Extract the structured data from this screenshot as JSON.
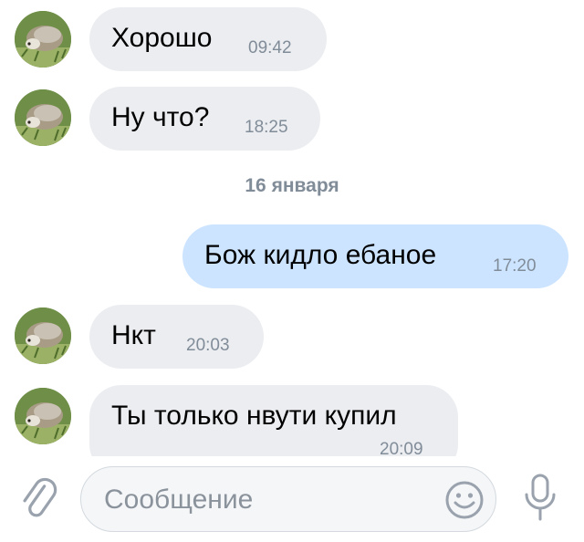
{
  "messages": [
    {
      "direction": "in",
      "text": "Хорошо",
      "time": "09:42"
    },
    {
      "direction": "in",
      "text": "Ну что?",
      "time": "18:25"
    },
    {
      "direction": "out",
      "text": "Бож кидло ебаное",
      "time": "17:20"
    },
    {
      "direction": "in",
      "text": "Нкт",
      "time": "20:03"
    },
    {
      "direction": "in",
      "text": "Ты только нвути купил",
      "time": "20:09"
    }
  ],
  "date_separator": "16 января",
  "composer": {
    "placeholder": "Сообщение"
  },
  "icons": {
    "attach": "paperclip-icon",
    "emoji": "smiley-icon",
    "mic": "microphone-icon"
  },
  "colors": {
    "incoming_bubble": "#ebedf0",
    "outgoing_bubble": "#cce4ff",
    "time_text": "#818c99",
    "icon": "#99a2ad"
  }
}
